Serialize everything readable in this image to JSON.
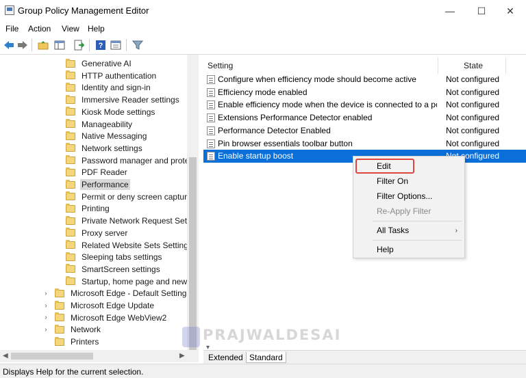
{
  "window": {
    "title": "Group Policy Management Editor",
    "minimize_glyph": "—",
    "maximize_glyph": "☐",
    "close_glyph": "✕"
  },
  "menu": [
    "File",
    "Action",
    "View",
    "Help"
  ],
  "toolbar": {
    "icons": [
      "back-icon",
      "forward-icon",
      "up-folder-icon",
      "show-hide-tree-icon",
      "export-list-icon",
      "help-icon",
      "properties-icon",
      "filter-icon"
    ]
  },
  "tree": {
    "items": [
      {
        "label": "Generative AI",
        "indent": 1
      },
      {
        "label": "HTTP authentication",
        "indent": 1
      },
      {
        "label": "Identity and sign-in",
        "indent": 1
      },
      {
        "label": "Immersive Reader settings",
        "indent": 1
      },
      {
        "label": "Kiosk Mode settings",
        "indent": 1
      },
      {
        "label": "Manageability",
        "indent": 1
      },
      {
        "label": "Native Messaging",
        "indent": 1
      },
      {
        "label": "Network settings",
        "indent": 1
      },
      {
        "label": "Password manager and protect",
        "indent": 1
      },
      {
        "label": "PDF Reader",
        "indent": 1
      },
      {
        "label": "Performance",
        "indent": 1,
        "selected": true
      },
      {
        "label": "Permit or deny screen capture",
        "indent": 1
      },
      {
        "label": "Printing",
        "indent": 1
      },
      {
        "label": "Private Network Request Settin",
        "indent": 1
      },
      {
        "label": "Proxy server",
        "indent": 1
      },
      {
        "label": "Related Website Sets Settings",
        "indent": 1
      },
      {
        "label": "Sleeping tabs settings",
        "indent": 1
      },
      {
        "label": "SmartScreen settings",
        "indent": 1
      },
      {
        "label": "Startup, home page and new ta",
        "indent": 1
      },
      {
        "label": "Microsoft Edge - Default Settings (",
        "indent": 0,
        "expander": true
      },
      {
        "label": "Microsoft Edge Update",
        "indent": 0,
        "expander": true
      },
      {
        "label": "Microsoft Edge WebView2",
        "indent": 0,
        "expander": true
      },
      {
        "label": "Network",
        "indent": 0,
        "expander": true
      },
      {
        "label": "Printers",
        "indent": 0,
        "expander": false
      }
    ]
  },
  "list": {
    "columns": {
      "setting": "Setting",
      "state": "State"
    },
    "rows": [
      {
        "setting": "Configure when efficiency mode should become active",
        "state": "Not configured"
      },
      {
        "setting": "Efficiency mode enabled",
        "state": "Not configured"
      },
      {
        "setting": "Enable efficiency mode when the device is connected to a po...",
        "state": "Not configured"
      },
      {
        "setting": "Extensions Performance Detector enabled",
        "state": "Not configured"
      },
      {
        "setting": "Performance Detector Enabled",
        "state": "Not configured"
      },
      {
        "setting": "Pin browser essentials toolbar button",
        "state": "Not configured"
      },
      {
        "setting": "Enable startup boost",
        "state": "Not configured",
        "selected": true
      }
    ]
  },
  "context_menu": {
    "edit": "Edit",
    "filter_on": "Filter On",
    "filter_options": "Filter Options...",
    "reapply_filter": "Re-Apply Filter",
    "all_tasks": "All Tasks",
    "help": "Help",
    "submenu_arrow": "›"
  },
  "tabs": {
    "extended": "Extended",
    "standard": "Standard"
  },
  "watermark": "PRAJWALDESAI",
  "status": "Displays Help for the current selection.",
  "colors": {
    "selection": "#0a6fd8",
    "highlight_box": "#e0453d",
    "folder": "#f5d67a"
  }
}
